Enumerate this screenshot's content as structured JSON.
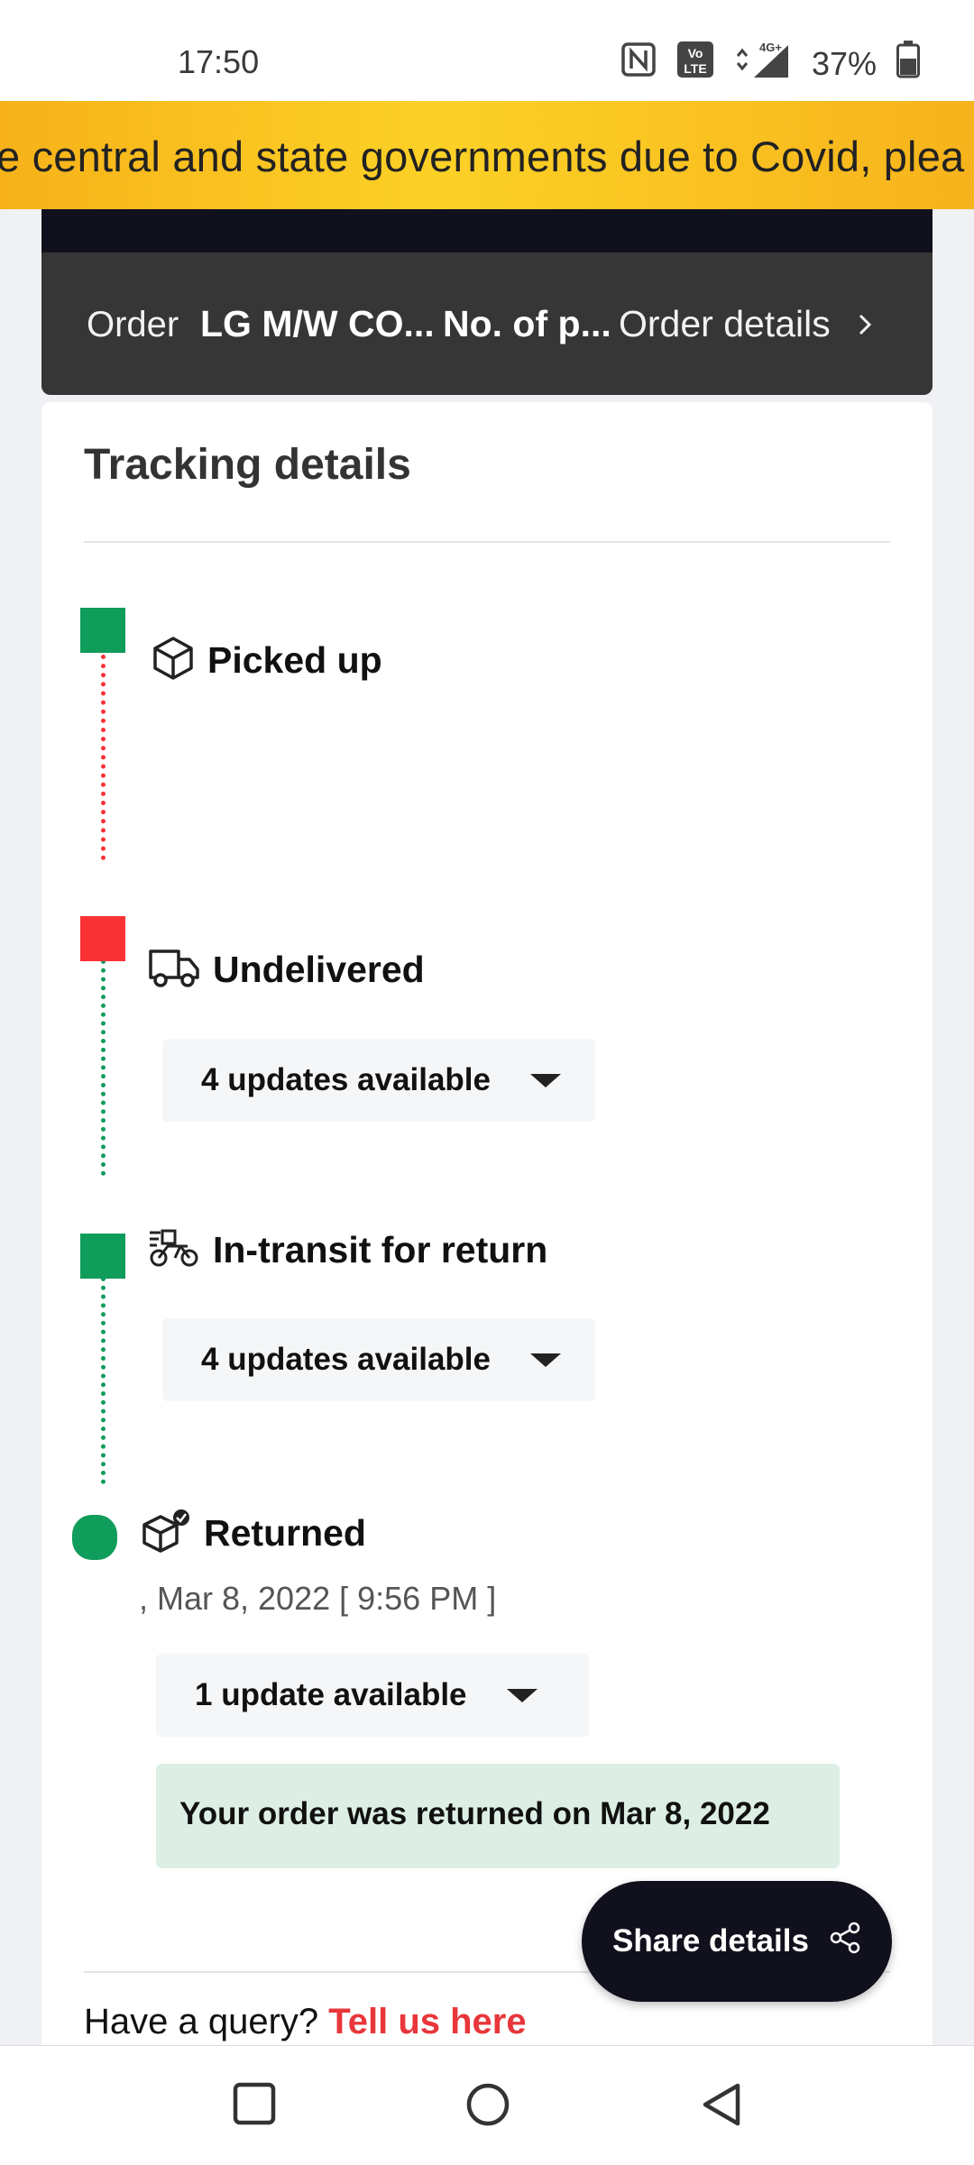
{
  "status_bar": {
    "time": "17:50",
    "network": "4G+",
    "battery": "37%",
    "icons": [
      "nfc-icon",
      "volte-icon",
      "signal-icon",
      "battery-icon"
    ]
  },
  "banner": {
    "text": "e central and state governments due to Covid, plea"
  },
  "order": {
    "label": "Order",
    "product_name": "LG M/W CO...",
    "pieces": "No. of p...",
    "details_link": "Order details"
  },
  "tracking": {
    "title": "Tracking details",
    "steps": [
      {
        "title": "Picked up",
        "icon": "box-icon",
        "status_color": "#109c5b"
      },
      {
        "title": "Undelivered",
        "icon": "truck-icon",
        "status_color": "#fa3236",
        "updates_label": "4 updates available"
      },
      {
        "title": "In-transit for return",
        "icon": "bike-delivery-icon",
        "status_color": "#109c5b",
        "updates_label": "4 updates available"
      },
      {
        "title": "Returned",
        "icon": "box-check-icon",
        "status_color": "#109c5b",
        "date": ", Mar 8, 2022 [ 9:56 PM ]",
        "updates_label": "1 update available"
      }
    ],
    "returned_notice": "Your order was returned on Mar 8, 2022"
  },
  "query": {
    "prompt": "Have a query?",
    "link": "Tell us here"
  },
  "share": {
    "label": "Share details",
    "icon": "share-icon"
  },
  "colors": {
    "accent_red": "#e8363a",
    "success_green": "#109c5b",
    "banner_yellow": "#fcd126",
    "dark": "#11111d"
  }
}
